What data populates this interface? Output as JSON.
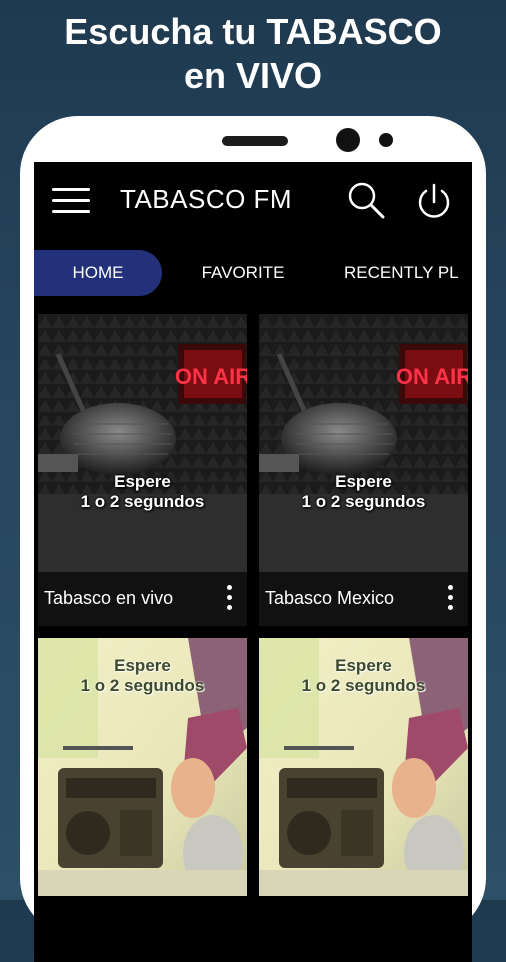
{
  "headline": {
    "line1": "Escucha tu TABASCO",
    "line2": "en VIVO"
  },
  "app": {
    "title": "TABASCO FM"
  },
  "tabs": [
    {
      "label": "HOME",
      "active": true
    },
    {
      "label": "FAVORITE",
      "active": false
    },
    {
      "label": "RECENTLY PL",
      "active": false
    }
  ],
  "stations": [
    {
      "name": "Tabasco en vivo",
      "overlay_line1": "Espere",
      "overlay_line2": "1 o 2 segundos",
      "image_sign": "ON AIR"
    },
    {
      "name": "Tabasco Mexico",
      "overlay_line1": "Espere",
      "overlay_line2": "1 o 2 segundos",
      "image_sign": "ON AIR"
    },
    {
      "name": "",
      "overlay_line1": "Espere",
      "overlay_line2": "1 o 2 segundos"
    },
    {
      "name": "",
      "overlay_line1": "Espere",
      "overlay_line2": "1 o 2 segundos"
    }
  ],
  "colors": {
    "background": "#27465f",
    "active_tab": "#22317a",
    "on_air_red": "#e3162a"
  }
}
